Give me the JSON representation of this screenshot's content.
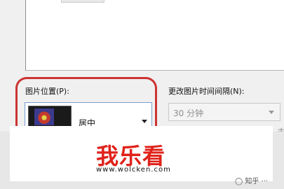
{
  "settings": {
    "picture_position_label": "图片位置(P):",
    "picture_position_value": "居中",
    "change_interval_label": "更改图片时间间隔(N):",
    "change_interval_value": "30 分钟",
    "side_fragment": "击"
  },
  "watermark": {
    "title": "我乐看",
    "url": "www.wolcken.com",
    "bottom_right": "◯ 知乎 ···"
  },
  "colors": {
    "highlight_border": "#cc3333",
    "watermark_red": "#e0221a",
    "select_border_active": "#7aa0d4"
  },
  "icons": {
    "dropdown": "chevron-down-icon",
    "thumbnail": "wallpaper-thumbnail-icon"
  }
}
